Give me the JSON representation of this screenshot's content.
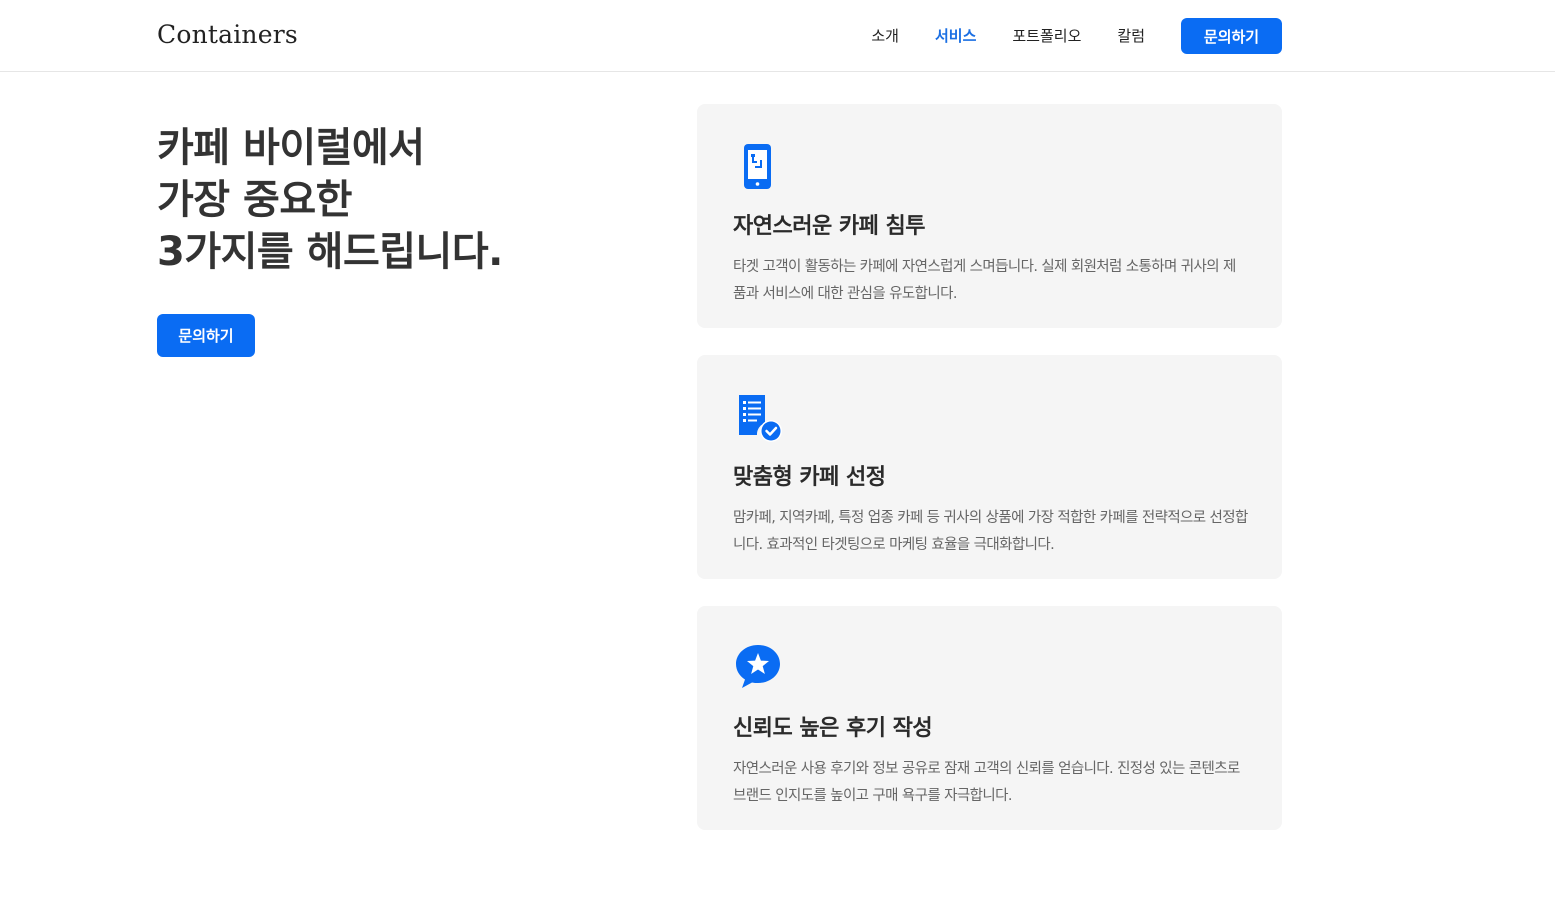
{
  "header": {
    "logo": "Containers",
    "nav": [
      {
        "label": "소개",
        "active": false
      },
      {
        "label": "서비스",
        "active": true
      },
      {
        "label": "포트폴리오",
        "active": false
      },
      {
        "label": "칼럼",
        "active": false
      }
    ],
    "cta_label": "문의하기"
  },
  "hero": {
    "title_lines": [
      "카페 바이럴에서",
      "가장 중요한",
      "3가지를 해드립니다."
    ],
    "cta_label": "문의하기"
  },
  "cards": [
    {
      "icon": "smartphone-icon",
      "title": "자연스러운 카페 침투",
      "body": "타겟 고객이 활동하는 카페에 자연스럽게 스며듭니다. 실제 회원처럼 소통하며 귀사의 제품과 서비스에 대한 관심을 유도합니다."
    },
    {
      "icon": "checklist-document-icon",
      "title": "맞춤형 카페 선정",
      "body": "맘카페, 지역카페, 특정 업종 카페 등 귀사의 상품에 가장 적합한 카페를 전략적으로 선정합니다. 효과적인 타겟팅으로 마케팅 효율을 극대화합니다."
    },
    {
      "icon": "star-chat-bubble-icon",
      "title": "신뢰도 높은 후기 작성",
      "body": "자연스러운 사용 후기와 정보 공유로 잠재 고객의 신뢰를 얻습니다. 진정성 있는 콘텐츠로 브랜드 인지도를 높이고 구매 욕구를 자극합니다."
    }
  ],
  "colors": {
    "accent": "#0a6cf3",
    "card_bg": "#f5f5f5",
    "nav_active": "#1b6fe3"
  }
}
